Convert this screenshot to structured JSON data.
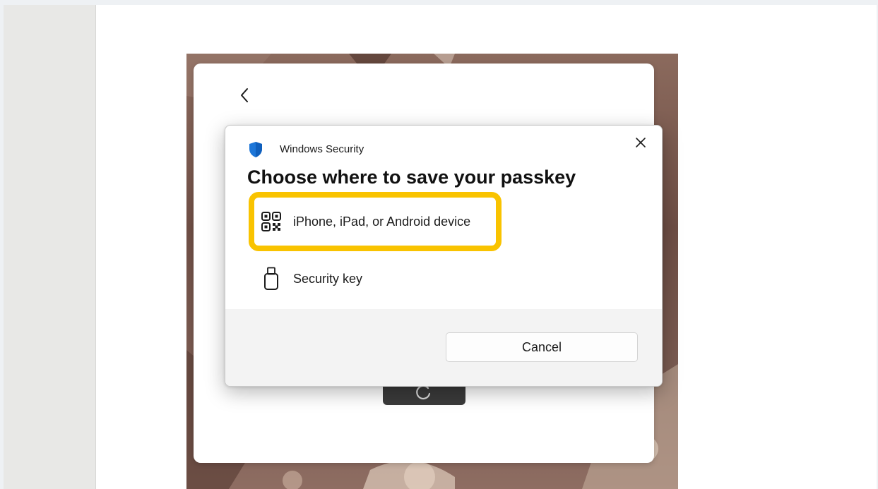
{
  "dialog": {
    "app_name": "Windows Security",
    "title": "Choose where to save your passkey",
    "options": [
      {
        "label": "iPhone, iPad, or Android device",
        "icon": "qr-code-icon",
        "highlighted": true
      },
      {
        "label": "Security key",
        "icon": "usb-key-icon",
        "highlighted": false
      }
    ],
    "cancel_label": "Cancel"
  },
  "colors": {
    "highlight": "#f9c300",
    "shield": "#1d76d8"
  }
}
